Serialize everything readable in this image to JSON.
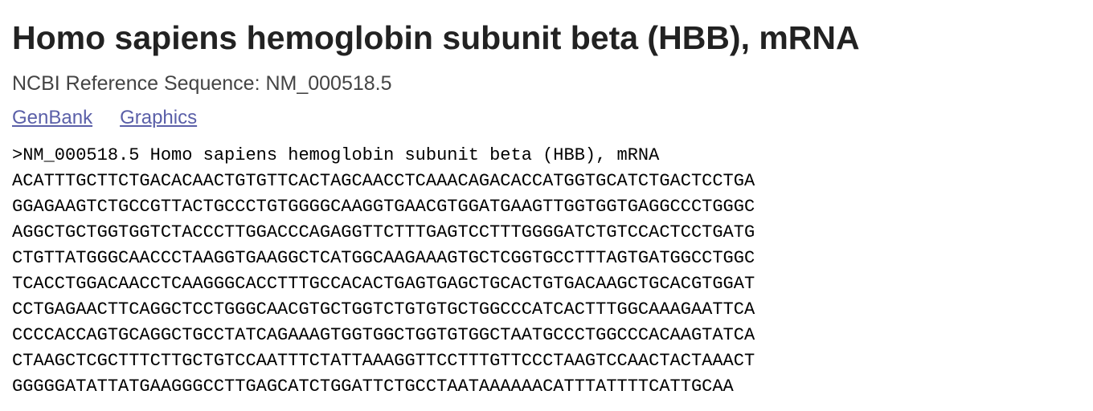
{
  "header": {
    "title": "Homo sapiens hemoglobin subunit beta (HBB), mRNA",
    "subtitle": "NCBI Reference Sequence: NM_000518.5"
  },
  "links": [
    {
      "label": "GenBank"
    },
    {
      "label": "Graphics"
    }
  ],
  "fasta": {
    "header_line": ">NM_000518.5 Homo sapiens hemoglobin subunit beta (HBB), mRNA",
    "lines": [
      "ACATTTGCTTCTGACACAACTGTGTTCACTAGCAACCTCAAACAGACACCATGGTGCATCTGACTCCTGA",
      "GGAGAAGTCTGCCGTTACTGCCCTGTGGGGCAAGGTGAACGTGGATGAAGTTGGTGGTGAGGCCCTGGGC",
      "AGGCTGCTGGTGGTCTACCCTTGGACCCAGAGGTTCTTTGAGTCCTTTGGGGATCTGTCCACTCCTGATG",
      "CTGTTATGGGCAACCCTAAGGTGAAGGCTCATGGCAAGAAAGTGCTCGGTGCCTTTAGTGATGGCCTGGC",
      "TCACCTGGACAACCTCAAGGGCACCTTTGCCACACTGAGTGAGCTGCACTGTGACAAGCTGCACGTGGAT",
      "CCTGAGAACTTCAGGCTCCTGGGCAACGTGCTGGTCTGTGTGCTGGCCCATCACTTTGGCAAAGAATTCA",
      "CCCCACCAGTGCAGGCTGCCTATCAGAAAGTGGTGGCTGGTGTGGCTAATGCCCTGGCCCACAAGTATCA",
      "CTAAGCTCGCTTTCTTGCTGTCCAATTTCTATTAAAGGTTCCTTTGTTCCCTAAGTCCAACTACTAAACT",
      "GGGGGATATTATGAAGGGCCTTGAGCATCTGGATTCTGCCTAATAAAAAACATTTATTTTCATTGCAA"
    ]
  }
}
